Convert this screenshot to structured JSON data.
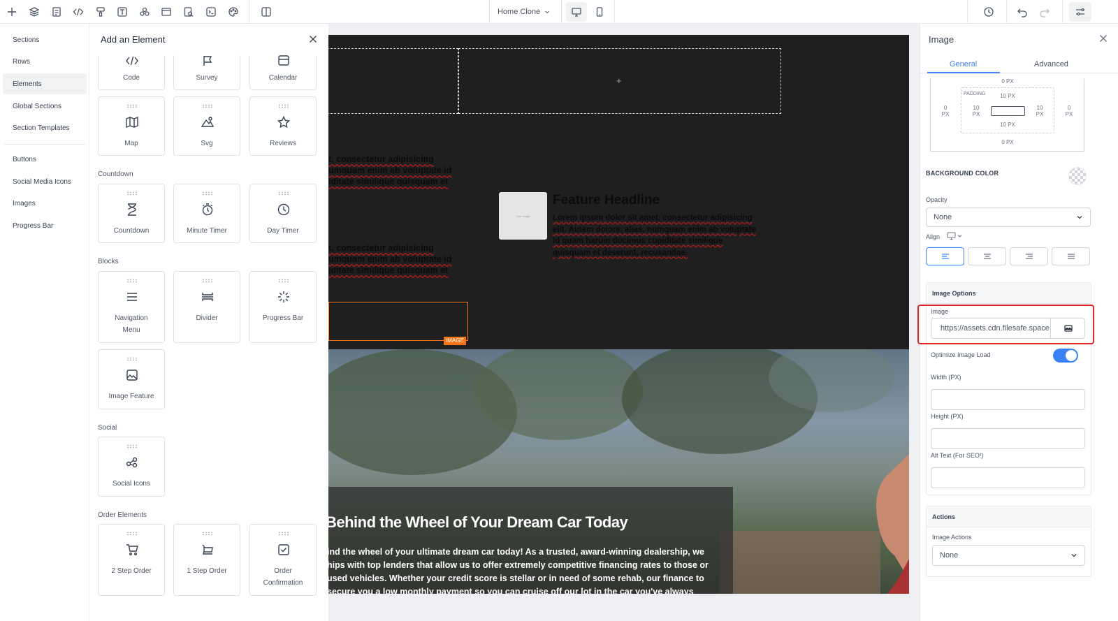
{
  "toolbar": {
    "page_select": "Home Clone",
    "left_icons": [
      "plus-icon",
      "layers-icon",
      "page-icon",
      "code-icon",
      "paint-icon",
      "text-icon",
      "people-icon",
      "layout-icon",
      "search-doc-icon",
      "terminal-icon",
      "palette-icon",
      "split-view-icon"
    ],
    "right_icons": [
      "desktop-icon",
      "mobile-icon",
      "history-icon",
      "undo-icon",
      "redo-icon",
      "settings-icon"
    ]
  },
  "sidebar": {
    "items": [
      "Sections",
      "Rows",
      "Elements",
      "Global Sections",
      "Section Templates",
      "Buttons",
      "Social Media Icons",
      "Images",
      "Progress Bar"
    ],
    "active": "Elements"
  },
  "element_panel": {
    "title": "Add an Element",
    "top_row": [
      "Code",
      "Survey",
      "Calendar"
    ],
    "row2": [
      "Map",
      "Svg",
      "Reviews"
    ],
    "countdown": {
      "title": "Countdown",
      "items": [
        "Countdown",
        "Minute Timer",
        "Day Timer"
      ]
    },
    "blocks": {
      "title": "Blocks",
      "items": [
        "Navigation Menu",
        "Divider",
        "Progress Bar",
        "Image Feature"
      ]
    },
    "social": {
      "title": "Social",
      "items": [
        "Social Icons"
      ]
    },
    "order": {
      "title": "Order Elements",
      "items": [
        "2 Step Order",
        "1 Step Order",
        "Order Confirmation"
      ]
    }
  },
  "canvas": {
    "plus": "+",
    "left_text_1": "t, consectetur adipisicing umquam enim ab voluptate id iditate similique quisquam et",
    "left_text_2": "t, consectetur adipisicing umquam enim ab voluptate id iditate similique quisquam et",
    "feature_img_text": "Your Image",
    "feature_headline": "Feature Headline",
    "feature_body": "Lorem ipsum dolor sit amet, consectetur adipisicing elit. Autem dolore, alias, numquam enim ab voluptate id quam harum ducimus cupiditate similique quisquam et deserunt, recusandae.",
    "image_tag": "IMAGE",
    "hero_title": "Behind the Wheel of Your Dream Car Today",
    "hero_body": "ind the wheel of your ultimate dream car today! As a trusted, award-winning dealership, we hips with top lenders that allow us to offer extremely competitive financing rates to those or used vehicles. Whether your credit score is stellar or in need of some rehab, our finance to secure you a low monthly payment so you can cruise off our lot in the car you've always"
  },
  "properties": {
    "title": "Image",
    "tabs": [
      "General",
      "Advanced"
    ],
    "active_tab": "General",
    "spacing": {
      "margin_top": "0 PX",
      "padding_label": "PADDING",
      "padding_top": "10 PX",
      "padding_left": "10",
      "padding_right": "10",
      "padding_bottom": "10 PX",
      "margin_left": "0",
      "margin_right": "0",
      "margin_bottom": "0 PX",
      "px": "PX"
    },
    "background_color_label": "BACKGROUND COLOR",
    "opacity_label": "Opacity",
    "opacity_value": "None",
    "align_label": "Align",
    "image_options": {
      "title": "Image Options",
      "image_label": "Image",
      "image_value": "https://assets.cdn.filesafe.space",
      "optimize_label": "Optimize Image Load",
      "optimize_on": true,
      "width_label": "Width (PX)",
      "height_label": "Height (PX)",
      "alt_label": "Alt Text (For SEO!)"
    },
    "actions": {
      "title": "Actions",
      "image_actions_label": "Image Actions",
      "image_actions_value": "None"
    }
  },
  "colors": {
    "accent": "#3b82f6",
    "highlight": "#e02424",
    "selection": "#f97316"
  }
}
